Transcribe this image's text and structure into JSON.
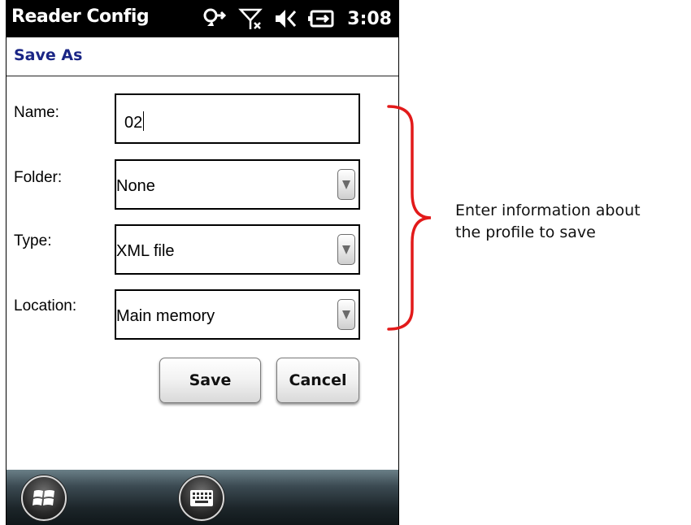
{
  "status_bar": {
    "app_title": "Reader Config",
    "time": "3:08",
    "icons": [
      "sync-icon",
      "no-signal-icon",
      "volume-icon",
      "battery-charging-icon"
    ]
  },
  "header": {
    "title": "Save As"
  },
  "form": {
    "name": {
      "label": "Name:",
      "value": "02"
    },
    "folder": {
      "label": "Folder:",
      "value": "None"
    },
    "type": {
      "label": "Type:",
      "value": "XML file"
    },
    "location": {
      "label": "Location:",
      "value": "Main memory"
    }
  },
  "buttons": {
    "save": "Save",
    "cancel": "Cancel"
  },
  "taskbar": {
    "icons": [
      "windows-start-icon",
      "keyboard-icon"
    ]
  },
  "annotation": {
    "line1": "Enter information about",
    "line2": "the profile to save",
    "color": "#e21a1a"
  },
  "colors": {
    "title_blue": "#1a2585",
    "status_bar": "#000000"
  }
}
